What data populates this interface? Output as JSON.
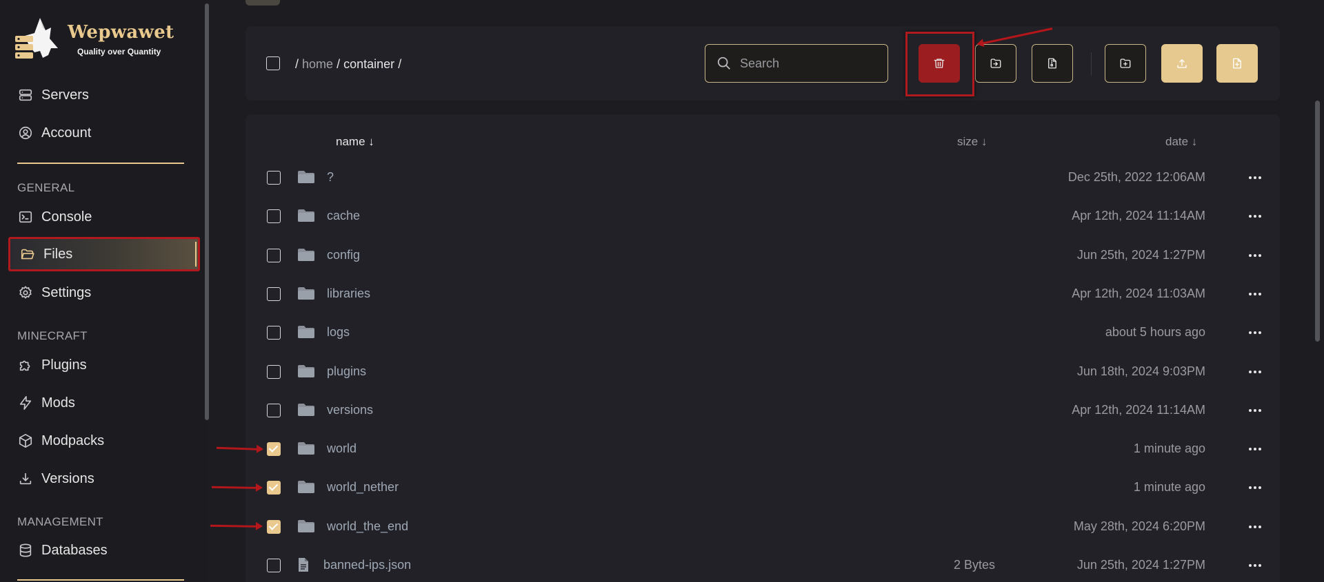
{
  "brand": {
    "name": "Wepwawet",
    "tagline": "Quality over Quantity"
  },
  "sidebar": {
    "top_items": [
      {
        "label": "Servers",
        "icon": "server-icon"
      },
      {
        "label": "Account",
        "icon": "user-circle-icon"
      }
    ],
    "sections": [
      {
        "title": "GENERAL",
        "items": [
          {
            "label": "Console",
            "icon": "terminal-icon"
          },
          {
            "label": "Files",
            "icon": "folder-open-icon",
            "active": true
          },
          {
            "label": "Settings",
            "icon": "gear-icon"
          }
        ]
      },
      {
        "title": "MINECRAFT",
        "items": [
          {
            "label": "Plugins",
            "icon": "puzzle-icon"
          },
          {
            "label": "Mods",
            "icon": "lightning-icon"
          },
          {
            "label": "Modpacks",
            "icon": "cube-icon"
          },
          {
            "label": "Versions",
            "icon": "download-icon"
          }
        ]
      },
      {
        "title": "MANAGEMENT",
        "items": [
          {
            "label": "Databases",
            "icon": "database-icon"
          }
        ]
      }
    ]
  },
  "toolbar": {
    "breadcrumb": {
      "sep1": "/",
      "home": "home",
      "sep2": "/",
      "current": "container",
      "sep3": "/"
    },
    "search_placeholder": "Search",
    "buttons": [
      "delete-icon",
      "move-icon",
      "archive-icon",
      "new-folder-icon",
      "upload-icon",
      "new-file-icon"
    ]
  },
  "table": {
    "headers": {
      "name": "name ↓",
      "size": "size ↓",
      "date": "date ↓"
    },
    "rows": [
      {
        "type": "folder",
        "name": "?",
        "size": "",
        "date": "Dec 25th, 2022 12:06AM",
        "checked": false
      },
      {
        "type": "folder",
        "name": "cache",
        "size": "",
        "date": "Apr 12th, 2024 11:14AM",
        "checked": false
      },
      {
        "type": "folder",
        "name": "config",
        "size": "",
        "date": "Jun 25th, 2024 1:27PM",
        "checked": false
      },
      {
        "type": "folder",
        "name": "libraries",
        "size": "",
        "date": "Apr 12th, 2024 11:03AM",
        "checked": false
      },
      {
        "type": "folder",
        "name": "logs",
        "size": "",
        "date": "about 5 hours ago",
        "checked": false
      },
      {
        "type": "folder",
        "name": "plugins",
        "size": "",
        "date": "Jun 18th, 2024 9:03PM",
        "checked": false
      },
      {
        "type": "folder",
        "name": "versions",
        "size": "",
        "date": "Apr 12th, 2024 11:14AM",
        "checked": false
      },
      {
        "type": "folder",
        "name": "world",
        "size": "",
        "date": "1 minute ago",
        "checked": true
      },
      {
        "type": "folder",
        "name": "world_nether",
        "size": "",
        "date": "1 minute ago",
        "checked": true
      },
      {
        "type": "folder",
        "name": "world_the_end",
        "size": "",
        "date": "May 28th, 2024 6:20PM",
        "checked": true
      },
      {
        "type": "file",
        "name": "banned-ips.json",
        "size": "2 Bytes",
        "date": "Jun 25th, 2024 1:27PM",
        "checked": false
      }
    ]
  },
  "colors": {
    "accent": "#e9c98e",
    "danger": "#9b1d1f",
    "annotation": "#b0191d"
  }
}
